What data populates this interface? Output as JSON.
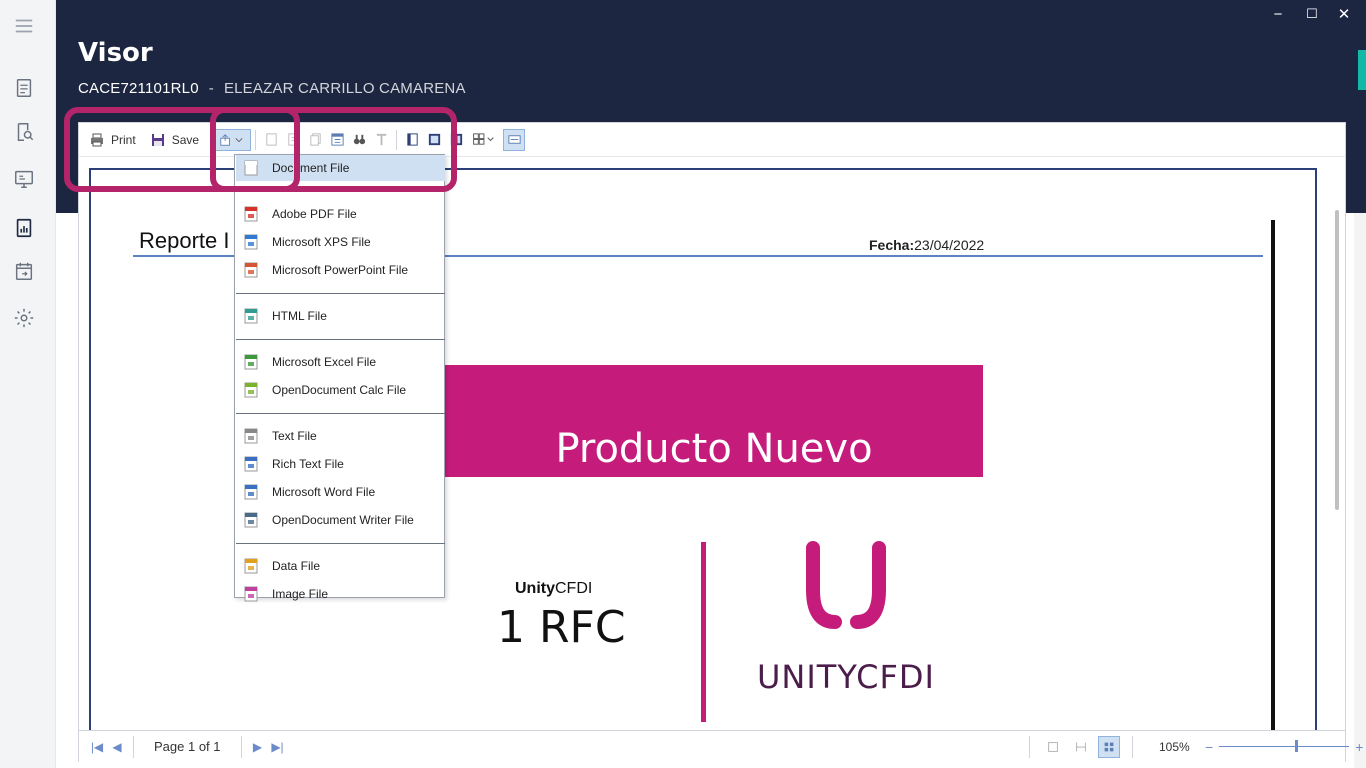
{
  "window": {
    "title": "Visor",
    "rfc": "CACE721101RL0",
    "separator": "-",
    "name": "ELEAZAR CARRILLO CAMARENA",
    "minimize": "−",
    "maximize": "☐",
    "close": "✕"
  },
  "sidebar": {
    "items": [
      {
        "icon": "menu-icon"
      },
      {
        "icon": "document-list-icon"
      },
      {
        "icon": "document-search-icon"
      },
      {
        "icon": "monitor-icon"
      },
      {
        "icon": "report-chart-icon"
      },
      {
        "icon": "calendar-icon"
      },
      {
        "icon": "gear-icon"
      }
    ]
  },
  "toolbar": {
    "print_label": "Print",
    "save_label": "Save"
  },
  "export_menu": {
    "groups": [
      [
        {
          "label": "Document File",
          "icon": "document-file-icon"
        }
      ],
      [
        {
          "label": "Adobe PDF File",
          "icon": "pdf-icon"
        },
        {
          "label": "Microsoft XPS File",
          "icon": "xps-icon"
        },
        {
          "label": "Microsoft PowerPoint File",
          "icon": "ppt-icon"
        }
      ],
      [
        {
          "label": "HTML File",
          "icon": "html-icon"
        }
      ],
      [
        {
          "label": "Microsoft Excel File",
          "icon": "excel-icon"
        },
        {
          "label": "OpenDocument Calc File",
          "icon": "ods-icon"
        }
      ],
      [
        {
          "label": "Text File",
          "icon": "txt-icon"
        },
        {
          "label": "Rich Text File",
          "icon": "rtf-icon"
        },
        {
          "label": "Microsoft Word File",
          "icon": "doc-icon"
        },
        {
          "label": "OpenDocument Writer File",
          "icon": "odt-icon"
        }
      ],
      [
        {
          "label": "Data File",
          "icon": "data-icon"
        },
        {
          "label": "Image File",
          "icon": "image-icon"
        }
      ]
    ]
  },
  "report": {
    "title": "Reporte I",
    "fecha_label": "Fecha:",
    "fecha_value": "23/04/2022",
    "banner": "Producto Nuevo",
    "unity_bold": "Unity",
    "unity_regular": "CFDI",
    "rfc_count": "1 RFC",
    "logo_text": "UNITYCFDI",
    "brand_color": "#c51c7c"
  },
  "statusbar": {
    "page_indicator": "Page 1 of 1",
    "zoom_label": "105%",
    "zoom_level_percent": 105,
    "zoom_minus": "−",
    "zoom_plus": "+"
  },
  "colors": {
    "header_bg": "#1c2640",
    "highlight": "#b3246a",
    "selection": "#cfe0f3"
  }
}
